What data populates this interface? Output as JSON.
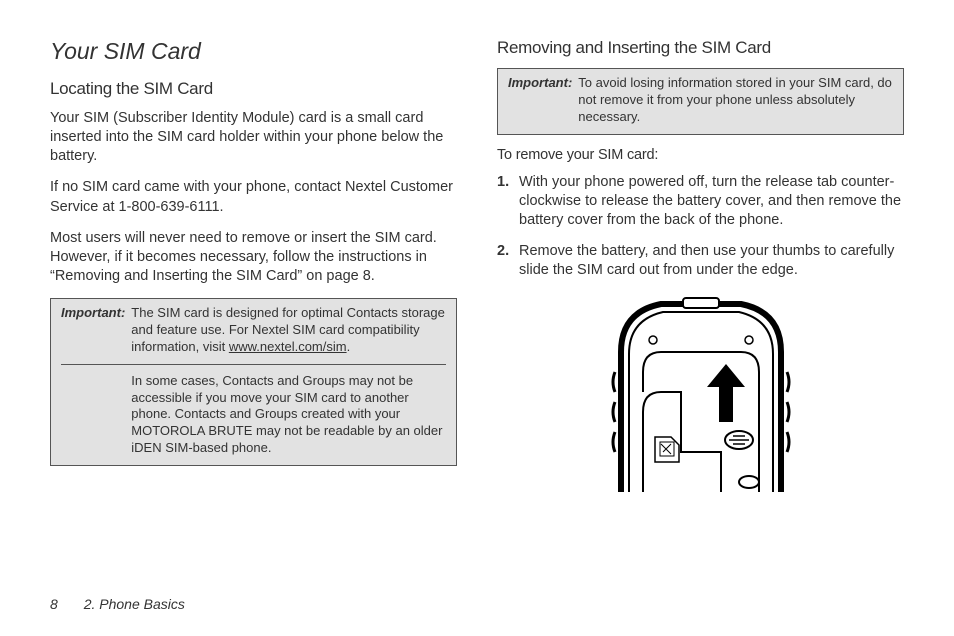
{
  "left": {
    "sectionTitle": "Your SIM Card",
    "subhead": "Locating the SIM Card",
    "p1": "Your SIM (Subscriber Identity Module) card is a small card inserted into the SIM card holder within your phone below the battery.",
    "p2": "If no SIM card came with your phone, contact Nextel Customer Service at 1-800-639-6111.",
    "p3": "Most users will never need to remove or insert the SIM card. However, if it becomes necessary, follow the instructions in “Removing and Inserting the SIM Card” on page 8.",
    "note": {
      "label": "Important:",
      "body1a": "The SIM card is designed for optimal Contacts storage and feature use. For Nextel SIM card compatibility information, visit ",
      "link": "www.nextel.com/sim",
      "body1b": ".",
      "body2": "In some cases, Contacts and Groups may not be accessible if you move your SIM card to another phone. Contacts and Groups created with your MOTOROLA BRUTE may not be readable by an older iDEN SIM-based phone."
    }
  },
  "right": {
    "subhead": "Removing and Inserting the SIM Card",
    "note": {
      "label": "Important:",
      "body": "To avoid losing information stored in your SIM card, do not remove it from your phone unless absolutely necessary."
    },
    "leadIn": "To remove your SIM card:",
    "steps": [
      "With your phone powered off, turn the release tab counter-clockwise to release the battery cover, and then remove the battery cover from the back of the phone.",
      "Remove the battery, and then use your thumbs to carefully slide the SIM card out from under the edge."
    ]
  },
  "footer": {
    "page": "8",
    "chapter": "2. Phone Basics"
  }
}
